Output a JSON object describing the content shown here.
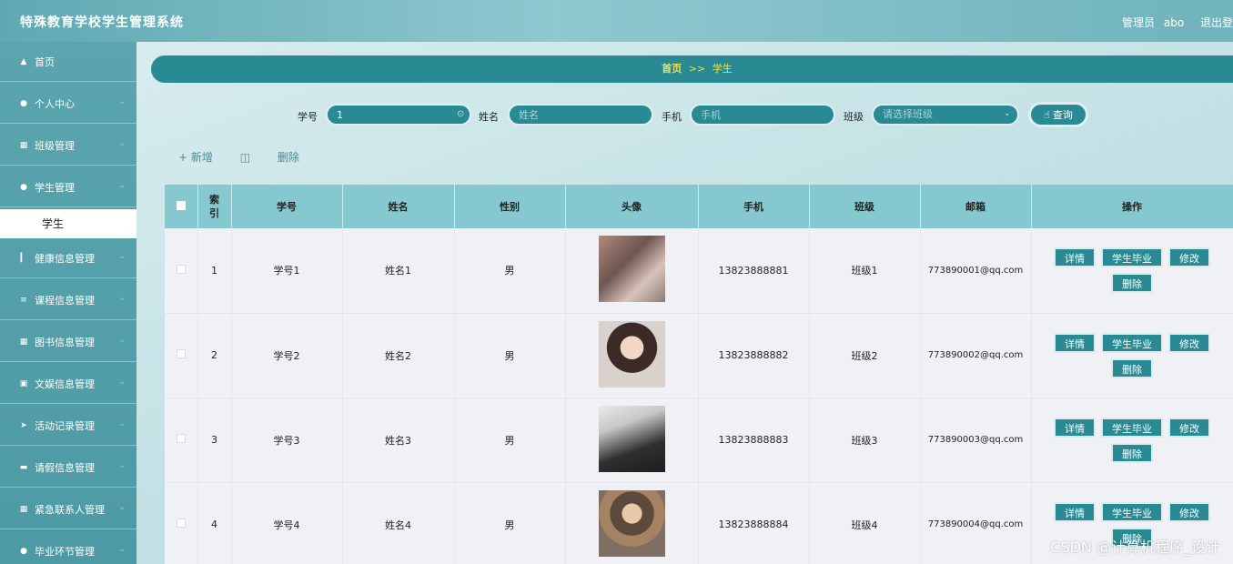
{
  "header": {
    "app_title": "特殊教育学校学生管理系统",
    "role": "管理员",
    "username": "abo",
    "logout": "退出登"
  },
  "sidebar": {
    "items": [
      {
        "label": "首页",
        "icon": "home-icon"
      },
      {
        "label": "个人中心",
        "icon": "user-icon"
      },
      {
        "label": "班级管理",
        "icon": "grid-icon"
      },
      {
        "label": "学生管理",
        "icon": "user-icon"
      },
      {
        "label": "健康信息管理",
        "icon": "bar-chart-icon"
      },
      {
        "label": "课程信息管理",
        "icon": "list-icon"
      },
      {
        "label": "图书信息管理",
        "icon": "grid-icon"
      },
      {
        "label": "文娱信息管理",
        "icon": "monitor-icon"
      },
      {
        "label": "活动记录管理",
        "icon": "send-icon"
      },
      {
        "label": "请假信息管理",
        "icon": "ticket-icon"
      },
      {
        "label": "紧急联系人管理",
        "icon": "grid-icon"
      },
      {
        "label": "毕业环节管理",
        "icon": "user-upload-icon"
      }
    ],
    "active_sub": "学生"
  },
  "breadcrumb": {
    "home": "首页",
    "sep": ">>",
    "current": "学生"
  },
  "search": {
    "id_label": "学号",
    "id_value": "1",
    "name_label": "姓名",
    "name_placeholder": "姓名",
    "phone_label": "手机",
    "phone_placeholder": "手机",
    "class_label": "班级",
    "class_placeholder": "请选择班级",
    "query_label": "查询"
  },
  "actions": {
    "add": "+ 新增",
    "delete": "删除"
  },
  "table": {
    "headers": [
      "索引",
      "学号",
      "姓名",
      "性别",
      "头像",
      "手机",
      "班级",
      "邮箱",
      "操作"
    ],
    "ops": {
      "detail": "详情",
      "graduate": "学生毕业",
      "edit": "修改",
      "delete": "删除"
    },
    "rows": [
      {
        "index": "1",
        "sid": "学号1",
        "name": "姓名1",
        "gender": "男",
        "phone": "13823888881",
        "class": "班级1",
        "email": "773890001@qq.com"
      },
      {
        "index": "2",
        "sid": "学号2",
        "name": "姓名2",
        "gender": "男",
        "phone": "13823888882",
        "class": "班级2",
        "email": "773890002@qq.com"
      },
      {
        "index": "3",
        "sid": "学号3",
        "name": "姓名3",
        "gender": "男",
        "phone": "13823888883",
        "class": "班级3",
        "email": "773890003@qq.com"
      },
      {
        "index": "4",
        "sid": "学号4",
        "name": "姓名4",
        "gender": "男",
        "phone": "13823888884",
        "class": "班级4",
        "email": "773890004@qq.com"
      }
    ]
  },
  "watermark": "CSDN @计算机程序_设计"
}
